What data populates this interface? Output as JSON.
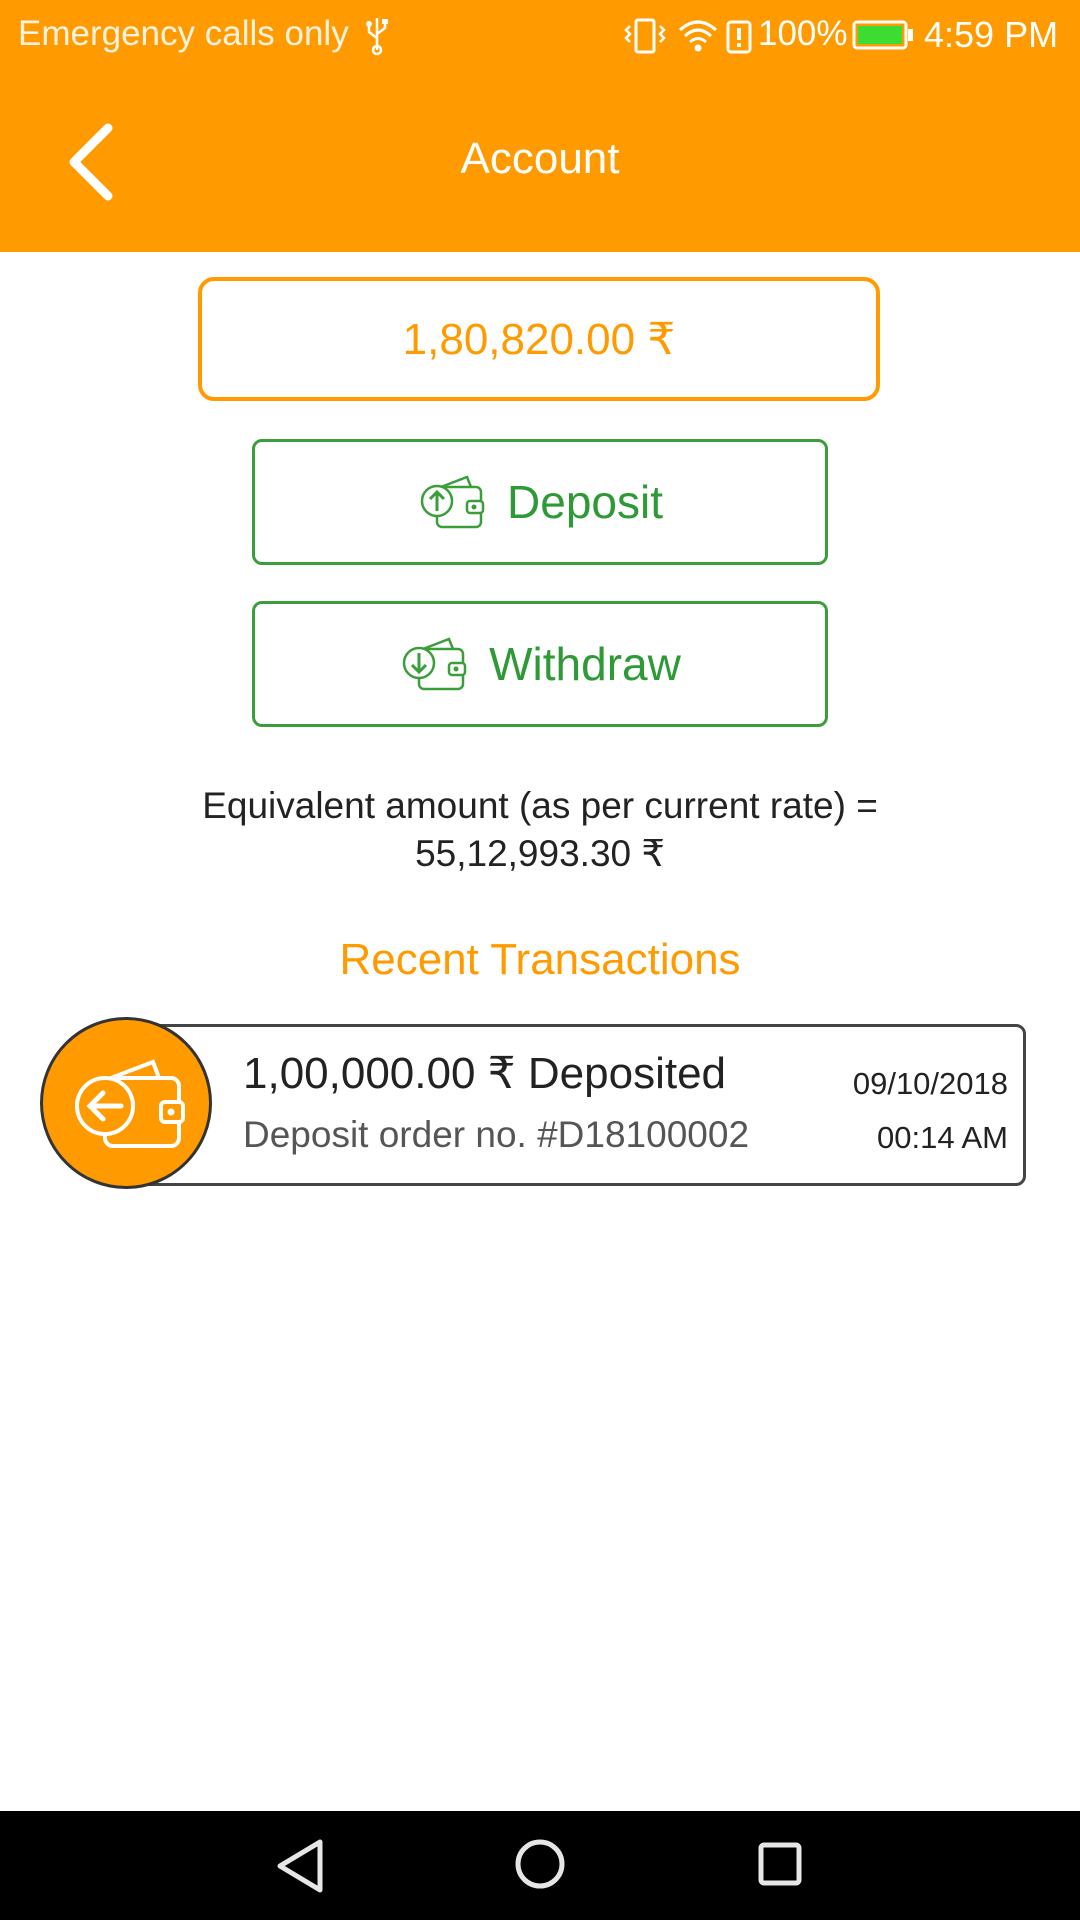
{
  "status_bar": {
    "carrier": "Emergency calls only",
    "battery_percent": "100%",
    "time": "4:59 PM",
    "icons": [
      "usb-icon",
      "vibrate-icon",
      "wifi-icon",
      "battery-saver-icon",
      "battery-icon"
    ]
  },
  "app_bar": {
    "title": "Account",
    "back_icon": "chevron-left-icon"
  },
  "account": {
    "balance": "1,80,820.00 ₹",
    "deposit_label": "Deposit",
    "withdraw_label": "Withdraw",
    "equivalent_line1": "Equivalent amount (as per current rate) =",
    "equivalent_line2": "55,12,993.30 ₹"
  },
  "recent_transactions": {
    "heading": "Recent Transactions",
    "items": [
      {
        "amount": "1,00,000.00 ₹ Deposited",
        "order": "Deposit order no. #D18100002",
        "date": "09/10/2018",
        "time": "00:14 AM",
        "icon": "wallet-in-icon"
      }
    ]
  },
  "nav_bar": {
    "icons": [
      "nav-back-icon",
      "nav-home-icon",
      "nav-recents-icon"
    ]
  },
  "colors": {
    "accent": "#ff9b00",
    "action_green": "#2e9a35",
    "nav_bg": "#000000"
  }
}
